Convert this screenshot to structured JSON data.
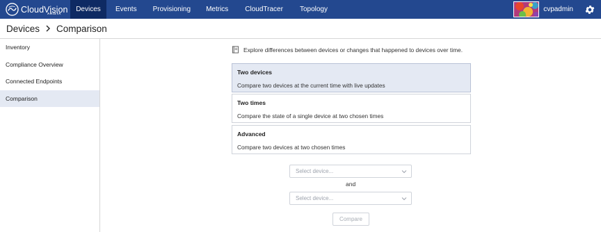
{
  "brand": {
    "name": "CloudVision",
    "sub": "ARISTA",
    "logo_icon": "cloudvision-logo-icon"
  },
  "nav": {
    "items": [
      {
        "label": "Devices",
        "active": true
      },
      {
        "label": "Events"
      },
      {
        "label": "Provisioning"
      },
      {
        "label": "Metrics"
      },
      {
        "label": "CloudTracer"
      },
      {
        "label": "Topology"
      }
    ],
    "username": "cvpadmin",
    "settings_icon": "gear-icon"
  },
  "header": {
    "section": "Devices",
    "separator_icon": "chevron-right-icon",
    "page": "Comparison"
  },
  "sidebar": {
    "items": [
      {
        "label": "Inventory"
      },
      {
        "label": "Compliance Overview"
      },
      {
        "label": "Connected Endpoints"
      },
      {
        "label": "Comparison",
        "active": true
      }
    ]
  },
  "main": {
    "intro_icon": "book-icon",
    "intro": "Explore differences between devices or changes that happened to devices over time.",
    "options": [
      {
        "title": "Two devices",
        "desc": "Compare two devices at the current time with live updates",
        "selected": true
      },
      {
        "title": "Two times",
        "desc": "Compare the state of a single device at two chosen times"
      },
      {
        "title": "Advanced",
        "desc": "Compare two devices at two chosen times"
      }
    ],
    "select1_placeholder": "Select device...",
    "and_label": "and",
    "select2_placeholder": "Select device...",
    "compare_label": "Compare"
  },
  "colors": {
    "nav_bg": "#23488f",
    "nav_active": "#0e2a63",
    "selected_bg": "#e4e9f3"
  }
}
